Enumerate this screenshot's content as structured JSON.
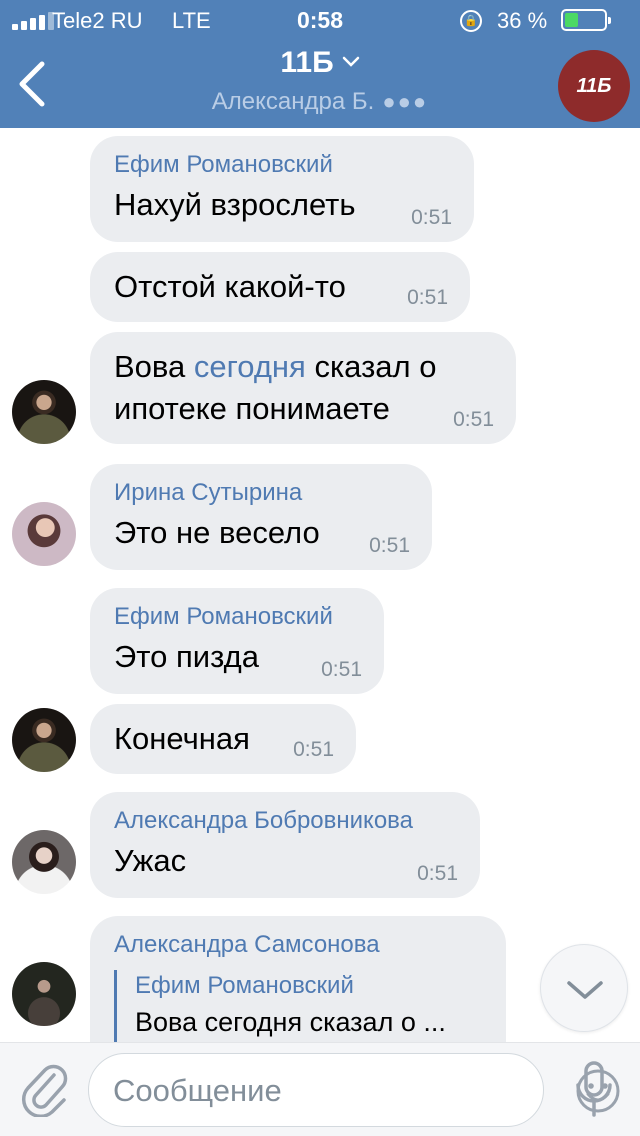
{
  "status_bar": {
    "carrier": "Tele2 RU",
    "network": "LTE",
    "time": "0:58",
    "battery_percent": "36 %",
    "battery_level": 0.36,
    "battery_color": "#4cd964"
  },
  "header": {
    "title": "11Б",
    "subtitle": "Александра Б.",
    "avatar_text": "11Б",
    "bar_color": "#5181b8",
    "avatar_color": "#8e2b2b"
  },
  "messages": [
    {
      "sender": "Ефим Романовский",
      "text": "Нахуй взрослеть",
      "time": "0:51"
    },
    {
      "sender": "",
      "text": "Отстой какой-то",
      "time": "0:51"
    },
    {
      "sender": "",
      "text_parts": [
        "Вова ",
        "сегодня",
        " сказал о"
      ],
      "text_line2": "ипотеке понимаете",
      "time": "0:51",
      "avatar": "boy-icon"
    },
    {
      "sender": "Ирина Сутырина",
      "text": "Это не весело",
      "time": "0:51",
      "avatar": "girl-icon"
    },
    {
      "sender": "Ефим Романовский",
      "text": "Это пизда",
      "time": "0:51"
    },
    {
      "sender": "",
      "text": "Конечная",
      "time": "0:51",
      "avatar": "boy-icon"
    },
    {
      "sender": "Александра Бобровникова",
      "text": "Ужас",
      "time": "0:51",
      "avatar": "girl-icon"
    },
    {
      "sender": "Александра Самсонова",
      "reply": {
        "sender": "Ефим Романовский",
        "text": "Вова сегодня сказал о ..."
      },
      "avatar": "girl-icon"
    }
  ],
  "input": {
    "placeholder": "Сообщение"
  },
  "icons": {
    "back": "chevron-left-icon",
    "title_chevron": "chevron-down-icon",
    "attach": "paperclip-icon",
    "emoji": "smiley-icon",
    "mic": "microphone-icon",
    "scroll_down": "chevron-down-icon"
  },
  "colors": {
    "accent": "#4f7ab2",
    "bubble": "#ebedf0",
    "time": "#828e99"
  }
}
